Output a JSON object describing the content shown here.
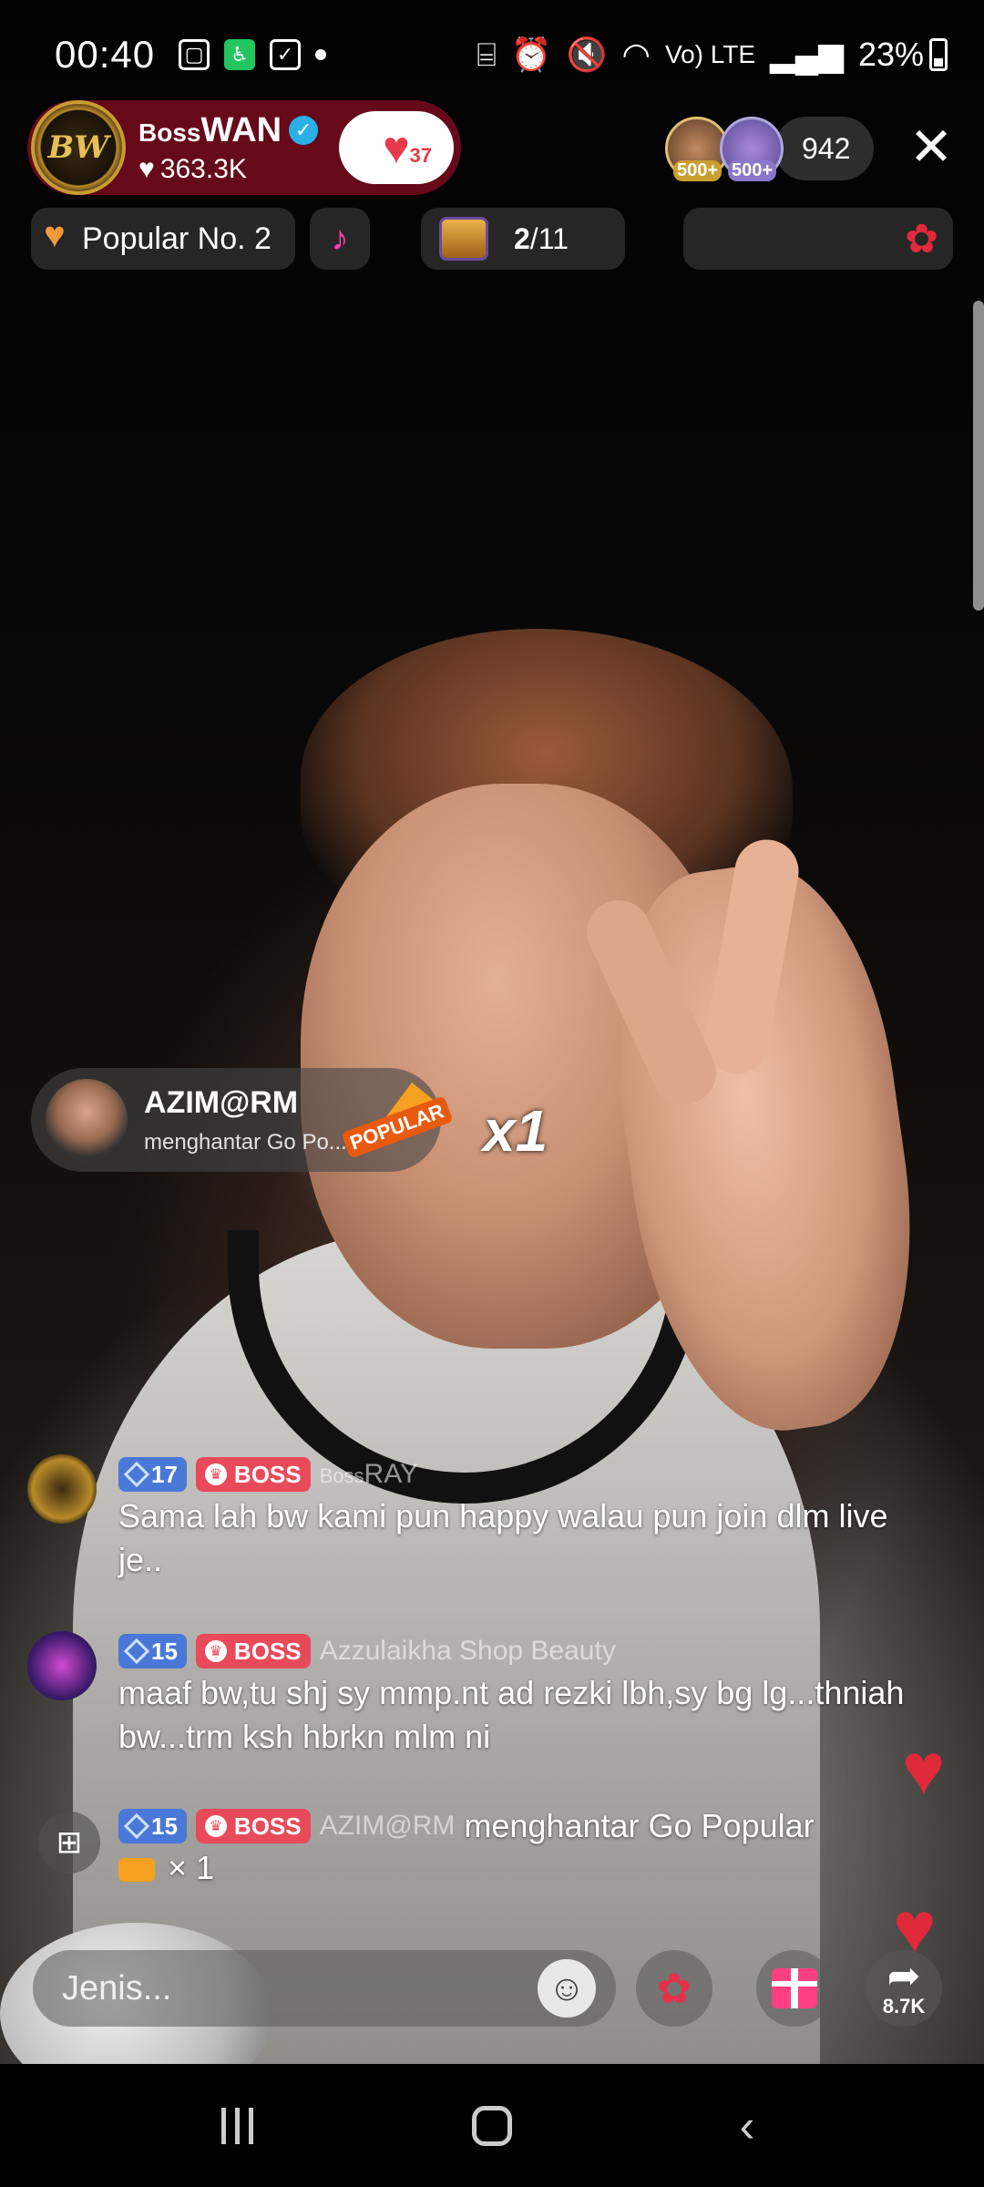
{
  "status_bar": {
    "time": "00:40",
    "network": "Vo) LTE",
    "battery": "23%"
  },
  "host": {
    "name_prefix": "Boss",
    "name": "WAN",
    "likes": "363.3K",
    "follow_badge_count": "37",
    "avatar_text": "BW"
  },
  "viewers": {
    "badge_1": "500+",
    "badge_2": "500+",
    "count": "942"
  },
  "tags": {
    "popular": "Popular No. 2",
    "treasure_current": "2",
    "treasure_total": "/11"
  },
  "gift_banner": {
    "sender": "AZIM@RM",
    "action": "menghantar Go Po...",
    "gift_label": "POPULAR",
    "multiplier": "x1"
  },
  "chat": [
    {
      "level": "17",
      "badge": "BOSS",
      "user_prefix": "Boss",
      "user": "RAY",
      "text": "Sama lah bw kami pun happy walau pun join dlm live je.."
    },
    {
      "level": "15",
      "badge": "BOSS",
      "user": "Azzulaikha Shop Beauty",
      "text": "maaf bw,tu shj sy mmp.nt ad rezki lbh,sy bg lg...thniah bw...trm ksh hbrkn mlm ni"
    },
    {
      "level": "15",
      "badge": "BOSS",
      "user": "AZIM@RM",
      "action": "menghantar Go Popular",
      "count": "× 1"
    }
  ],
  "bottom_bar": {
    "comment_placeholder": "Jenis...",
    "share_count": "8.7K"
  },
  "colors": {
    "host_capsule": "#780a1e",
    "level_badge": "#4a78d8",
    "boss_badge": "#e84a5a",
    "gift_button": "#ff3f82"
  }
}
